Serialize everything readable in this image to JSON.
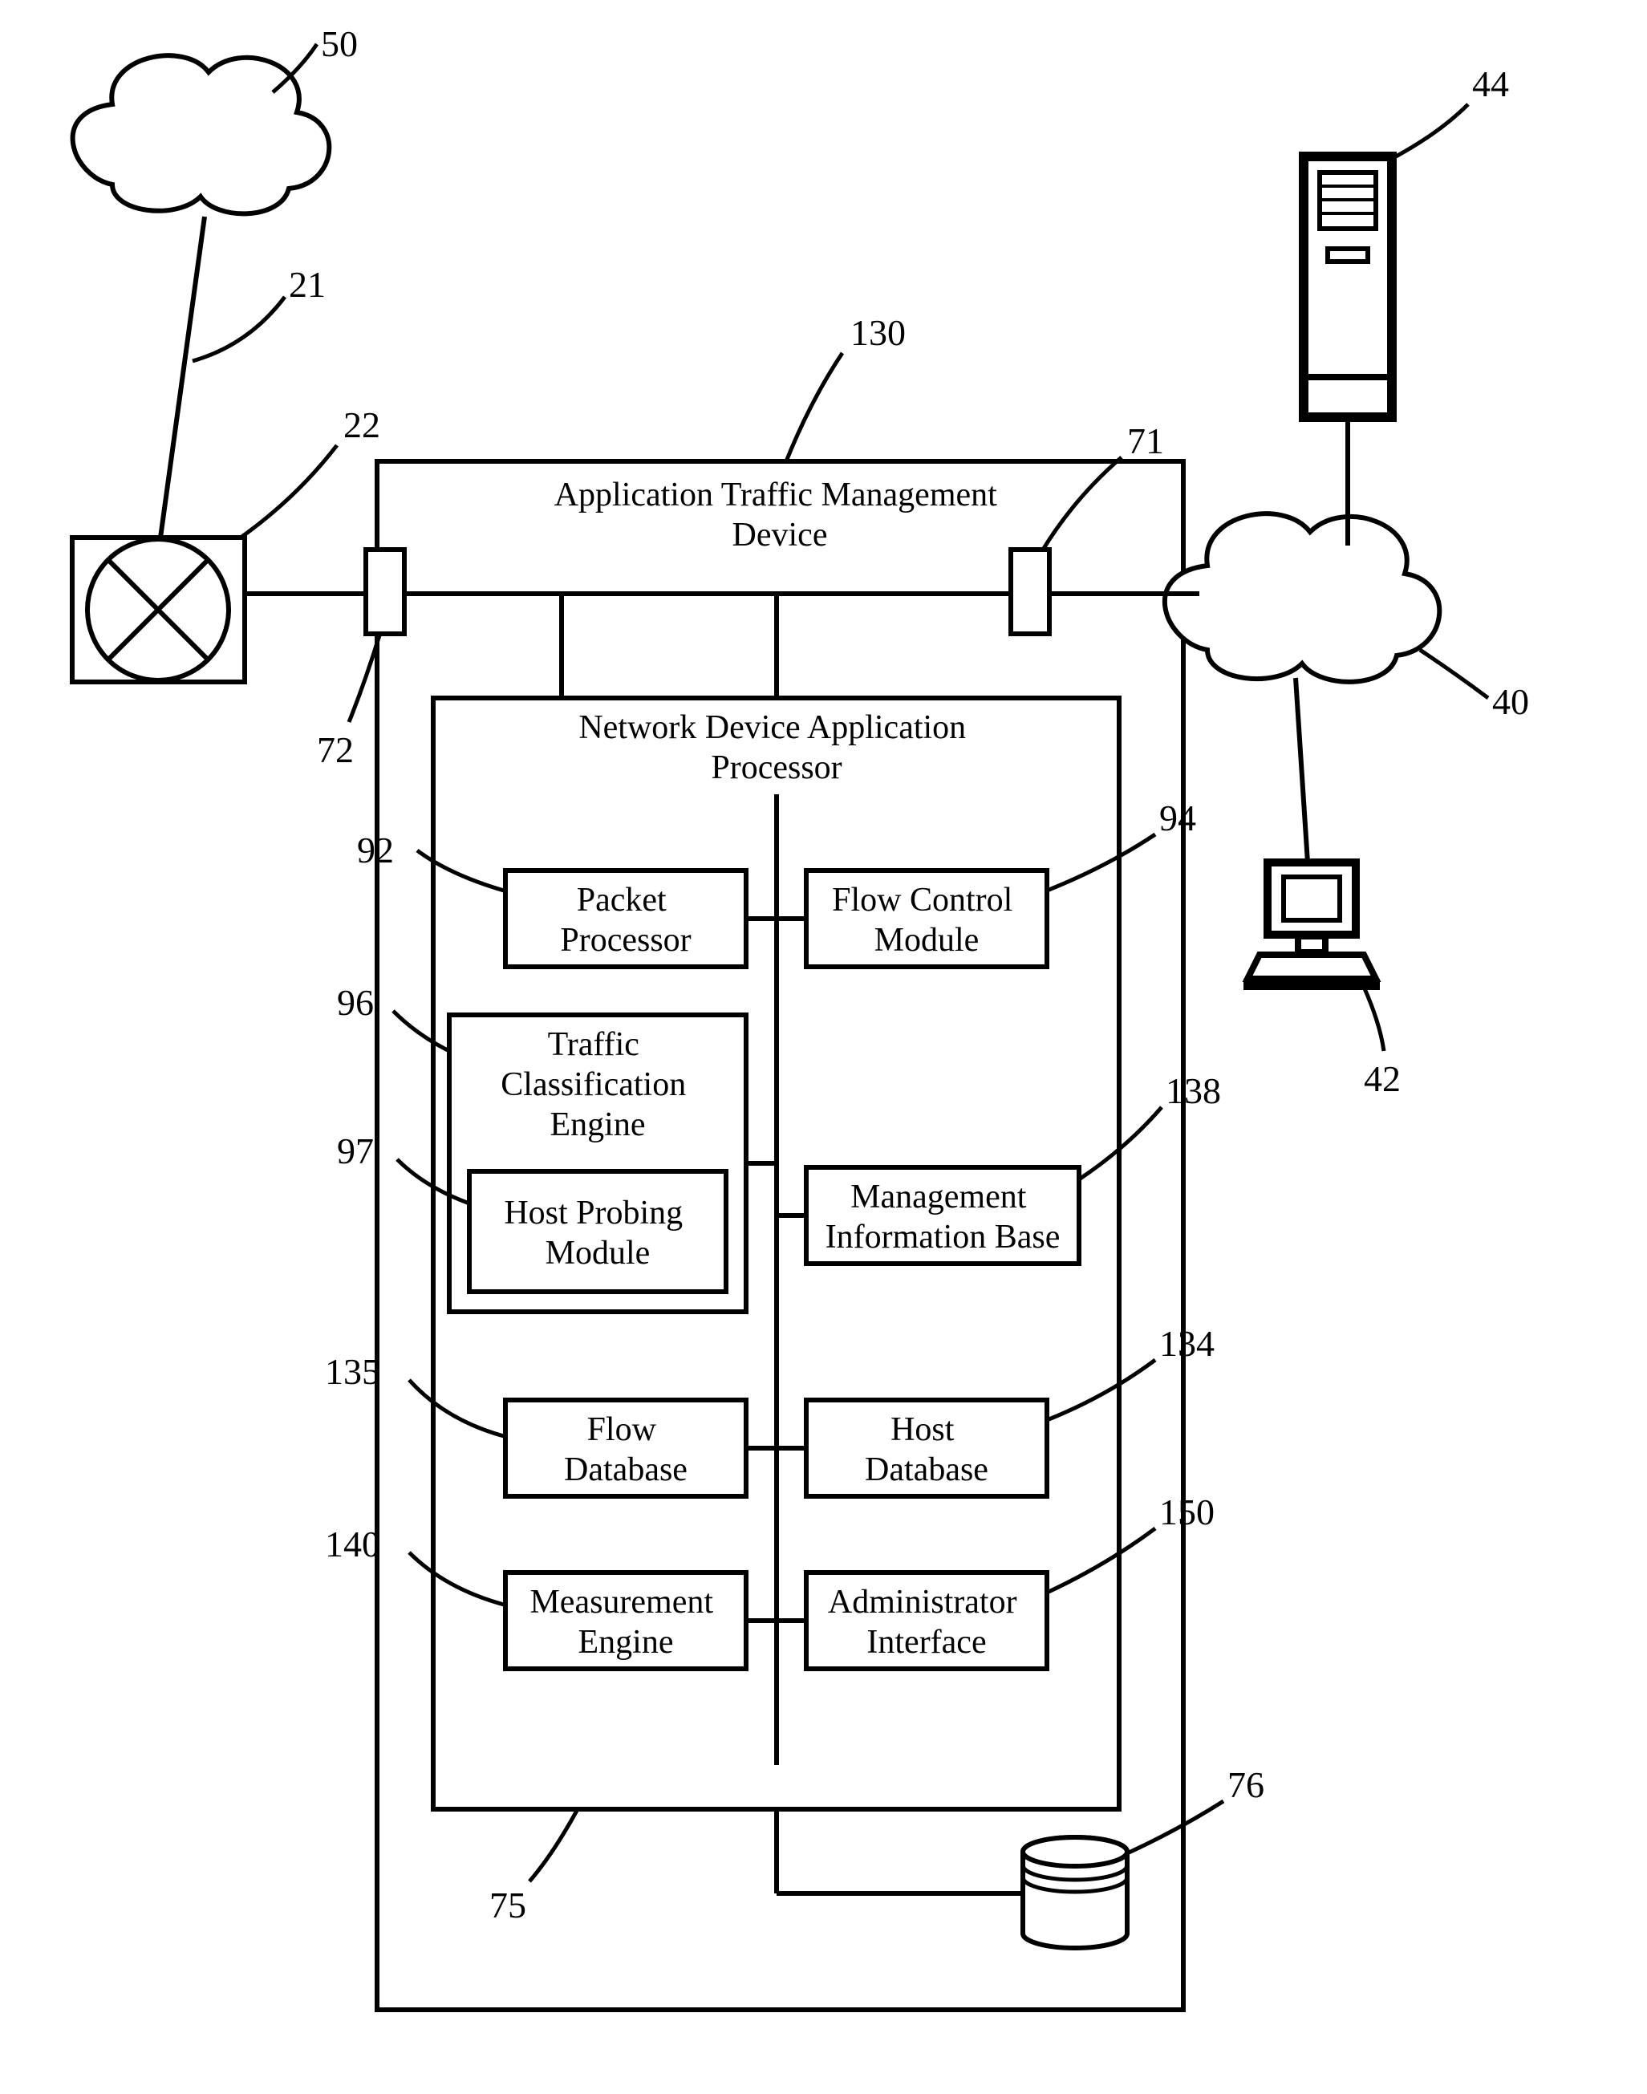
{
  "refs": {
    "r50": "50",
    "r21": "21",
    "r22": "22",
    "r72": "72",
    "r130": "130",
    "r71": "71",
    "r44": "44",
    "r40": "40",
    "r42": "42",
    "r92": "92",
    "r94": "94",
    "r96": "96",
    "r97": "97",
    "r135": "135",
    "r134": "134",
    "r138": "138",
    "r140": "140",
    "r150": "150",
    "r75": "75",
    "r76": "76"
  },
  "labels": {
    "atmd1": "Application Traffic Management",
    "atmd2": "Device",
    "ndap1": "Network Device Application",
    "ndap2": "Processor",
    "pp1": "Packet",
    "pp2": "Processor",
    "fcm1": "Flow Control",
    "fcm2": "Module",
    "tce1": "Traffic",
    "tce2": "Classification",
    "tce3": "Engine",
    "hpm1": "Host Probing",
    "hpm2": "Module",
    "mib1": "Management",
    "mib2": "Information Base",
    "fd1": "Flow",
    "fd2": "Database",
    "hd1": "Host",
    "hd2": "Database",
    "me1": "Measurement",
    "me2": "Engine",
    "ai1": "Administrator",
    "ai2": "Interface"
  }
}
